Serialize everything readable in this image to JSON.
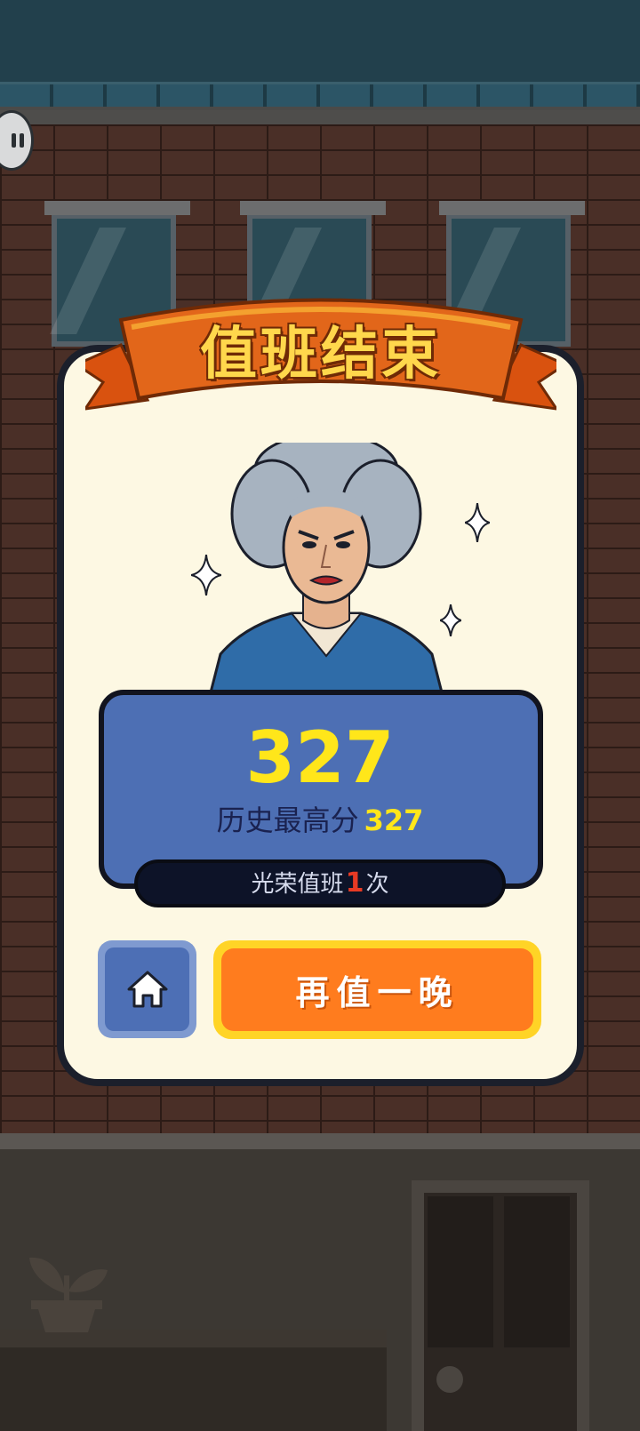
{
  "banner": {
    "title": "值班结束"
  },
  "result": {
    "score": "327",
    "best_label": "历史最高分",
    "best_value": "327",
    "duty_prefix": "光荣值班",
    "duty_count": "1",
    "duty_suffix": "次"
  },
  "buttons": {
    "home_icon": "home-icon",
    "again_label": "再值一晚"
  },
  "hud": {
    "pause_icon": "pause-icon"
  },
  "colors": {
    "card_bg": "#fdf8e3",
    "panel_blue": "#4d6fb4",
    "score_yellow": "#ffe61a",
    "ribbon_orange": "#d9520f",
    "again_orange": "#ff7c1e",
    "again_border": "#ffd426"
  }
}
